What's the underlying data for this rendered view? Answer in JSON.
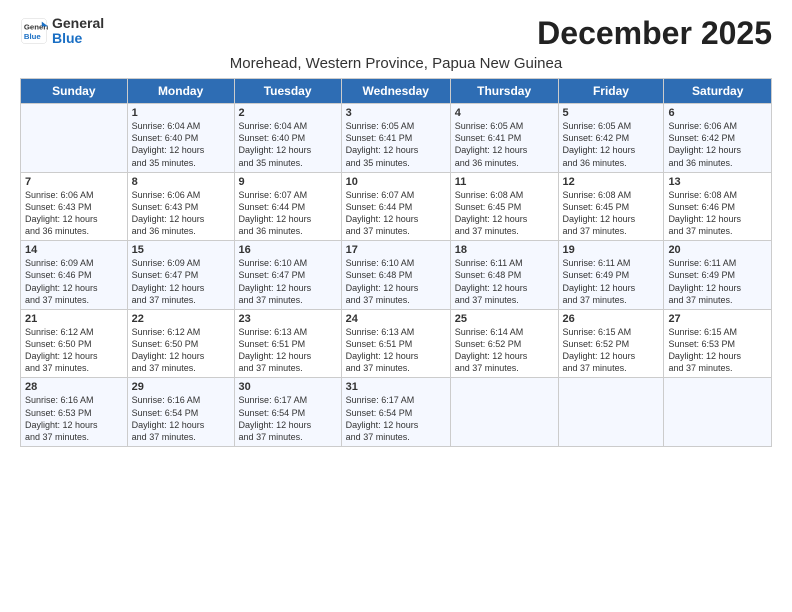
{
  "logo": {
    "line1": "General",
    "line2": "Blue"
  },
  "title": "December 2025",
  "subtitle": "Morehead, Western Province, Papua New Guinea",
  "days_header": [
    "Sunday",
    "Monday",
    "Tuesday",
    "Wednesday",
    "Thursday",
    "Friday",
    "Saturday"
  ],
  "weeks": [
    [
      {
        "day": "",
        "info": ""
      },
      {
        "day": "1",
        "info": "Sunrise: 6:04 AM\nSunset: 6:40 PM\nDaylight: 12 hours\nand 35 minutes."
      },
      {
        "day": "2",
        "info": "Sunrise: 6:04 AM\nSunset: 6:40 PM\nDaylight: 12 hours\nand 35 minutes."
      },
      {
        "day": "3",
        "info": "Sunrise: 6:05 AM\nSunset: 6:41 PM\nDaylight: 12 hours\nand 35 minutes."
      },
      {
        "day": "4",
        "info": "Sunrise: 6:05 AM\nSunset: 6:41 PM\nDaylight: 12 hours\nand 36 minutes."
      },
      {
        "day": "5",
        "info": "Sunrise: 6:05 AM\nSunset: 6:42 PM\nDaylight: 12 hours\nand 36 minutes."
      },
      {
        "day": "6",
        "info": "Sunrise: 6:06 AM\nSunset: 6:42 PM\nDaylight: 12 hours\nand 36 minutes."
      }
    ],
    [
      {
        "day": "7",
        "info": "Sunrise: 6:06 AM\nSunset: 6:43 PM\nDaylight: 12 hours\nand 36 minutes."
      },
      {
        "day": "8",
        "info": "Sunrise: 6:06 AM\nSunset: 6:43 PM\nDaylight: 12 hours\nand 36 minutes."
      },
      {
        "day": "9",
        "info": "Sunrise: 6:07 AM\nSunset: 6:44 PM\nDaylight: 12 hours\nand 36 minutes."
      },
      {
        "day": "10",
        "info": "Sunrise: 6:07 AM\nSunset: 6:44 PM\nDaylight: 12 hours\nand 37 minutes."
      },
      {
        "day": "11",
        "info": "Sunrise: 6:08 AM\nSunset: 6:45 PM\nDaylight: 12 hours\nand 37 minutes."
      },
      {
        "day": "12",
        "info": "Sunrise: 6:08 AM\nSunset: 6:45 PM\nDaylight: 12 hours\nand 37 minutes."
      },
      {
        "day": "13",
        "info": "Sunrise: 6:08 AM\nSunset: 6:46 PM\nDaylight: 12 hours\nand 37 minutes."
      }
    ],
    [
      {
        "day": "14",
        "info": "Sunrise: 6:09 AM\nSunset: 6:46 PM\nDaylight: 12 hours\nand 37 minutes."
      },
      {
        "day": "15",
        "info": "Sunrise: 6:09 AM\nSunset: 6:47 PM\nDaylight: 12 hours\nand 37 minutes."
      },
      {
        "day": "16",
        "info": "Sunrise: 6:10 AM\nSunset: 6:47 PM\nDaylight: 12 hours\nand 37 minutes."
      },
      {
        "day": "17",
        "info": "Sunrise: 6:10 AM\nSunset: 6:48 PM\nDaylight: 12 hours\nand 37 minutes."
      },
      {
        "day": "18",
        "info": "Sunrise: 6:11 AM\nSunset: 6:48 PM\nDaylight: 12 hours\nand 37 minutes."
      },
      {
        "day": "19",
        "info": "Sunrise: 6:11 AM\nSunset: 6:49 PM\nDaylight: 12 hours\nand 37 minutes."
      },
      {
        "day": "20",
        "info": "Sunrise: 6:11 AM\nSunset: 6:49 PM\nDaylight: 12 hours\nand 37 minutes."
      }
    ],
    [
      {
        "day": "21",
        "info": "Sunrise: 6:12 AM\nSunset: 6:50 PM\nDaylight: 12 hours\nand 37 minutes."
      },
      {
        "day": "22",
        "info": "Sunrise: 6:12 AM\nSunset: 6:50 PM\nDaylight: 12 hours\nand 37 minutes."
      },
      {
        "day": "23",
        "info": "Sunrise: 6:13 AM\nSunset: 6:51 PM\nDaylight: 12 hours\nand 37 minutes."
      },
      {
        "day": "24",
        "info": "Sunrise: 6:13 AM\nSunset: 6:51 PM\nDaylight: 12 hours\nand 37 minutes."
      },
      {
        "day": "25",
        "info": "Sunrise: 6:14 AM\nSunset: 6:52 PM\nDaylight: 12 hours\nand 37 minutes."
      },
      {
        "day": "26",
        "info": "Sunrise: 6:15 AM\nSunset: 6:52 PM\nDaylight: 12 hours\nand 37 minutes."
      },
      {
        "day": "27",
        "info": "Sunrise: 6:15 AM\nSunset: 6:53 PM\nDaylight: 12 hours\nand 37 minutes."
      }
    ],
    [
      {
        "day": "28",
        "info": "Sunrise: 6:16 AM\nSunset: 6:53 PM\nDaylight: 12 hours\nand 37 minutes."
      },
      {
        "day": "29",
        "info": "Sunrise: 6:16 AM\nSunset: 6:54 PM\nDaylight: 12 hours\nand 37 minutes."
      },
      {
        "day": "30",
        "info": "Sunrise: 6:17 AM\nSunset: 6:54 PM\nDaylight: 12 hours\nand 37 minutes."
      },
      {
        "day": "31",
        "info": "Sunrise: 6:17 AM\nSunset: 6:54 PM\nDaylight: 12 hours\nand 37 minutes."
      },
      {
        "day": "",
        "info": ""
      },
      {
        "day": "",
        "info": ""
      },
      {
        "day": "",
        "info": ""
      }
    ]
  ]
}
